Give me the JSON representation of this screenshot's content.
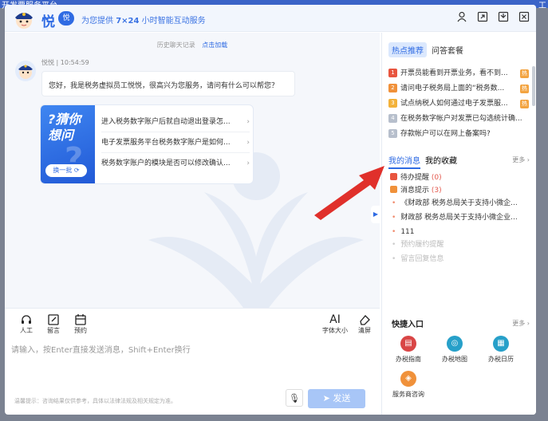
{
  "background": {
    "title": "开发票服务平台",
    "right": "工"
  },
  "header": {
    "logo_text": "悦",
    "badge_text": "悦",
    "slogan_pre": "为您提供 ",
    "slogan_bold": "7×24",
    "slogan_post": " 小时智能互动服务",
    "icons": [
      "user-icon",
      "expand-icon",
      "export-icon",
      "close-icon"
    ]
  },
  "chat": {
    "history_label": "历史聊天记录",
    "load_label": "点击加载",
    "bot_meta": "悦悦 | 10:54:59",
    "greeting": "您好，我是税务虚拟员工悦悦，很高兴为您服务，请问有什么可以帮您？",
    "card": {
      "ask_line1": "?猜你",
      "ask_line2": "想问",
      "swap_label": "换一批",
      "questions": [
        "进入税务数字账户后就自动退出登录怎...",
        "电子发票服务平台税务数字账户是如何...",
        "税务数字账户的模块是否可以修改确认..."
      ]
    }
  },
  "toolbar": {
    "human": "人工",
    "message": "留言",
    "booking": "预约",
    "font_icon": "AI",
    "font": "字体大小",
    "clear": "清屏"
  },
  "input": {
    "placeholder": "请输入，按Enter直接发送消息，Shift+Enter换行"
  },
  "footer": {
    "tip": "温馨提示：咨询结果仅供参考，具体以法律法规及相关规定为准。",
    "send": "发送"
  },
  "right": {
    "tabs": [
      "热点推荐",
      "问答套餐"
    ],
    "hot_items": [
      {
        "num": "1",
        "text": "开票员能看到开票业务，看不到...",
        "color": "#e8553f",
        "hot": true
      },
      {
        "num": "2",
        "text": "请问电子税务局上面的“税务数...",
        "color": "#f0913a",
        "hot": true
      },
      {
        "num": "3",
        "text": "试点纳税人如何通过电子发票服...",
        "color": "#f3b23a",
        "hot": true
      },
      {
        "num": "4",
        "text": "在税务数字帐户对发票已勾选统计确...",
        "color": "#b7bfcc",
        "hot": false
      },
      {
        "num": "5",
        "text": "存款帐户可以在网上备案吗?",
        "color": "#b7bfcc",
        "hot": false
      }
    ],
    "hot_tag": "热",
    "msg_tabs": [
      "我的消息",
      "我的收藏"
    ],
    "more": "更多 ›",
    "pending_label": "待办提醒",
    "pending_count": "(0)",
    "notice_label": "消息提示",
    "notice_count": "(3)",
    "messages": [
      "《财政部 税务总局关于支持小微企...",
      "财政部 税务总局关于支持小微企业...",
      "111"
    ],
    "dim_items": [
      "预约履约提醒",
      "留言回复信息"
    ],
    "quick_title": "快捷入口",
    "quick_more": "更多 ›",
    "quick_items": [
      {
        "label": "办税指南",
        "color": "#d94646",
        "glyph": "▤"
      },
      {
        "label": "办税地图",
        "color": "#27a0c9",
        "glyph": "◎"
      },
      {
        "label": "办税日历",
        "color": "#27a0c9",
        "glyph": "▦"
      },
      {
        "label": "服务商咨询",
        "color": "#f0913a",
        "glyph": "◈"
      }
    ]
  }
}
